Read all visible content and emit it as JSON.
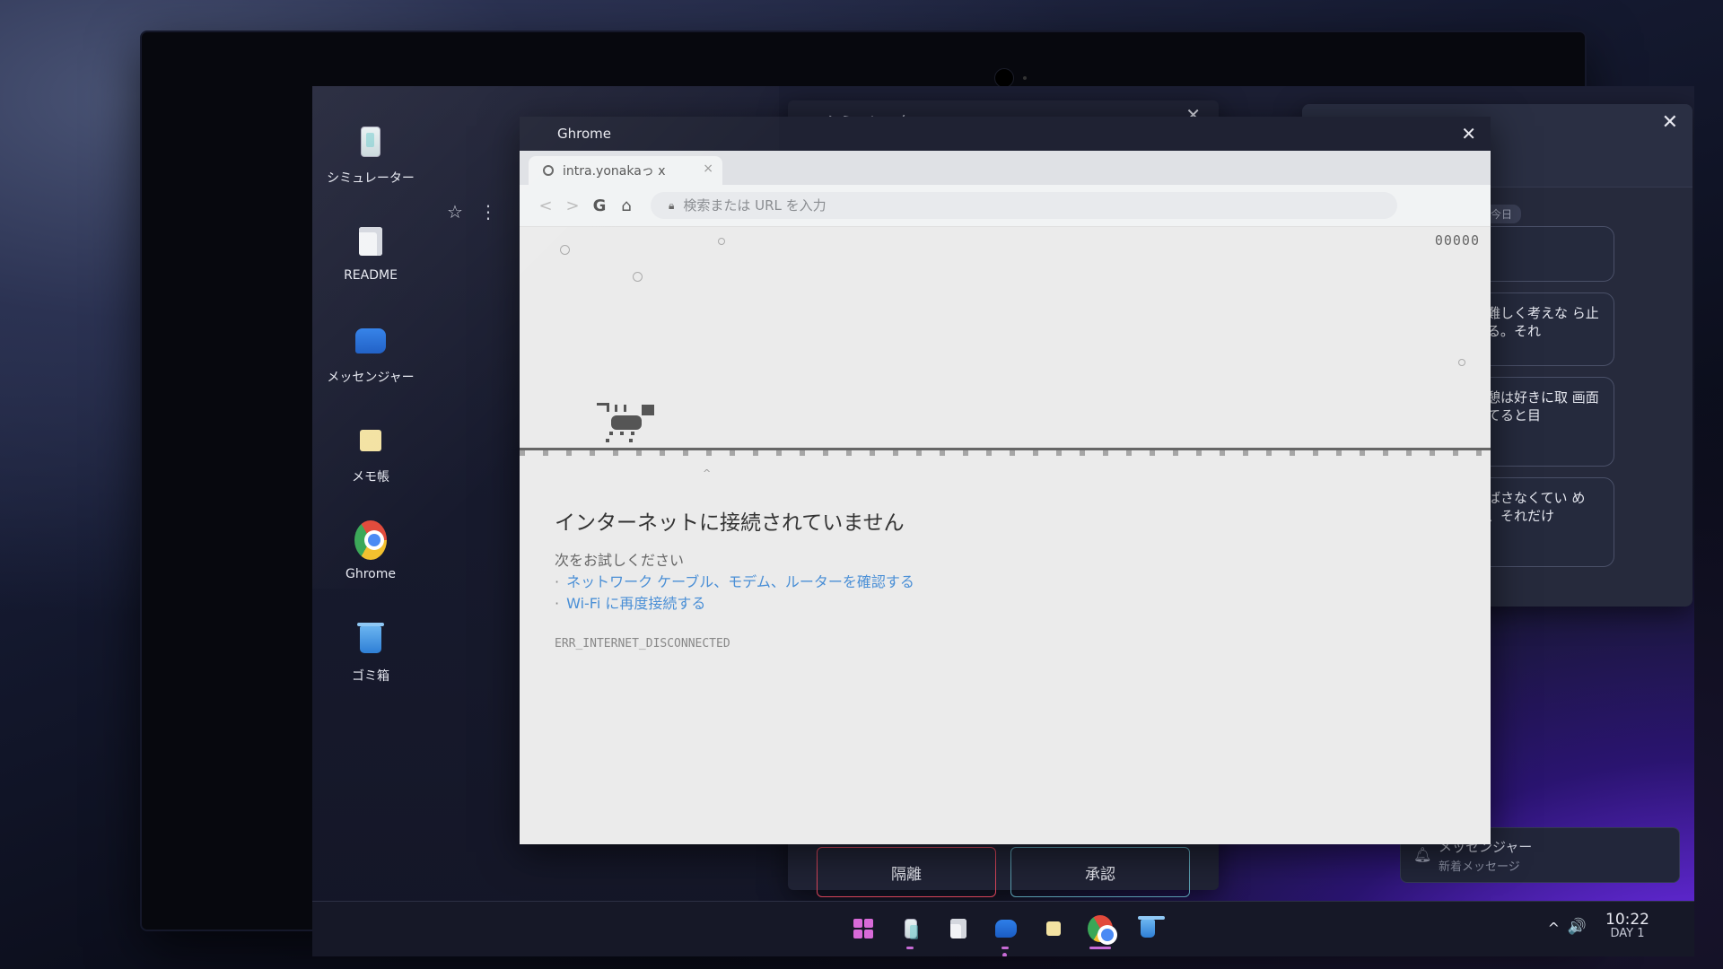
{
  "desktop": {
    "icons": [
      {
        "label": "シミュレーター",
        "icon": "phone-icon"
      },
      {
        "label": "README",
        "icon": "document-icon"
      },
      {
        "label": "メッセンジャー",
        "icon": "chat-icon"
      },
      {
        "label": "メモ帳",
        "icon": "memo-icon"
      },
      {
        "label": "Ghrome",
        "icon": "browser-icon"
      },
      {
        "label": "ゴミ箱",
        "icon": "trash-icon"
      }
    ],
    "tools": {
      "star": "☆",
      "more": "⋮"
    }
  },
  "simulator_window": {
    "title": "シミュレーター",
    "close": "✕",
    "reject_label": "隔離",
    "approve_label": "承認"
  },
  "messenger_window": {
    "close": "✕",
    "day_badge": "今日",
    "bubbles": [
      "",
      "。難しく考えな ら止める。それ",
      "休憩は好きに取 画面見てると目",
      "飛ばさなくてい める、それだけ"
    ]
  },
  "notification": {
    "title": "メッセンジャー",
    "subtitle": "新着メッセージ"
  },
  "browser": {
    "window_title": "Ghrome",
    "close": "✕",
    "tab_title": "intra.yonakaっ x",
    "tab_close": "×",
    "nav": {
      "back": "<",
      "forward": ">",
      "google": "G",
      "home": "⌂"
    },
    "url_placeholder": "検索または URL を入力",
    "score": "00000",
    "caret": "^",
    "error": {
      "title": "インターネットに接続されていません",
      "subtitle": "次をお試しください",
      "suggestions": [
        "ネットワーク ケーブル、モデム、ルーターを確認する",
        "Wi-Fi に再度接続する"
      ],
      "code": "ERR_INTERNET_DISCONNECTED"
    }
  },
  "taskbar": {
    "system_tray": "^",
    "volume": "🔊",
    "time": "10:22",
    "day": "DAY 1"
  },
  "colors": {
    "accent": "#c86bd6",
    "link": "#4a8fd6",
    "reject": "#d7455a"
  }
}
